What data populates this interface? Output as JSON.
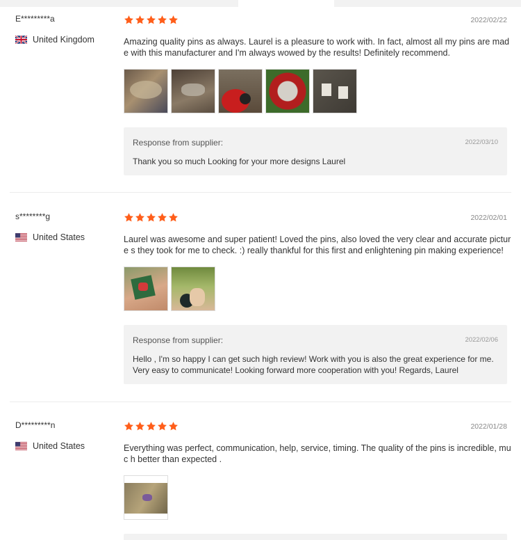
{
  "reviews": [
    {
      "user": "E*********a",
      "country": "United Kingdom",
      "flag_icon": "uk-flag-icon",
      "rating": 5,
      "date": "2022/02/22",
      "text": "Amazing quality pins as always. Laurel is a pleasure to work with. In fact, almost all my pins are made with this manufacturer and I'm always wowed by the results! Definitely recommend.",
      "photo_count": 5,
      "response": {
        "title": "Response from supplier:",
        "date": "2022/03/10",
        "text": "Thank you so much Looking for your more designs Laurel"
      }
    },
    {
      "user": "s********g",
      "country": "United States",
      "flag_icon": "us-flag-icon",
      "rating": 5,
      "date": "2022/02/01",
      "text": "Laurel was awesome and super patient! Loved the pins, also loved the very clear and accurate picture s they took for me to check. :) really thankful for this first and enlightening pin making experience!",
      "photo_count": 2,
      "response": {
        "title": "Response from supplier:",
        "date": "2022/02/06",
        "text": "Hello , I'm so happy I can get such high review! Work with you is also the great experience for me. Very easy to communicate! Looking forward more cooperation with you! Regards, Laurel"
      }
    },
    {
      "user": "D*********n",
      "country": "United States",
      "flag_icon": "us-flag-icon",
      "rating": 5,
      "date": "2022/01/28",
      "text": "Everything was perfect, communication, help, service, timing. The quality of the pins is incredible, muc h better than expected .",
      "photo_count": 1
    }
  ],
  "colors": {
    "star": "#ff5e1a",
    "response_bg": "#f2f2f2",
    "divider": "#ececec"
  }
}
